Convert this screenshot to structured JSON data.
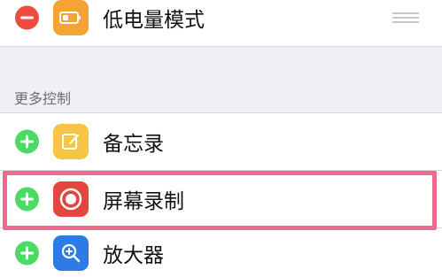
{
  "included": {
    "items": [
      {
        "label": "低电量模式",
        "icon": "battery-icon",
        "action": "remove",
        "color": "#f5a333"
      }
    ]
  },
  "more": {
    "header": "更多控制",
    "items": [
      {
        "label": "备忘录",
        "icon": "notes-icon",
        "action": "add",
        "color": "#f7c544"
      },
      {
        "label": "屏幕录制",
        "icon": "screen-record-icon",
        "action": "add",
        "color": "#e2463f",
        "highlighted": true
      },
      {
        "label": "放大器",
        "icon": "magnifier-icon",
        "action": "add",
        "color": "#2f7be5"
      }
    ]
  },
  "colors": {
    "remove": "#ef4b3f",
    "add": "#4cd964",
    "highlight": "#ef6a8e",
    "background": "#efeff4"
  }
}
